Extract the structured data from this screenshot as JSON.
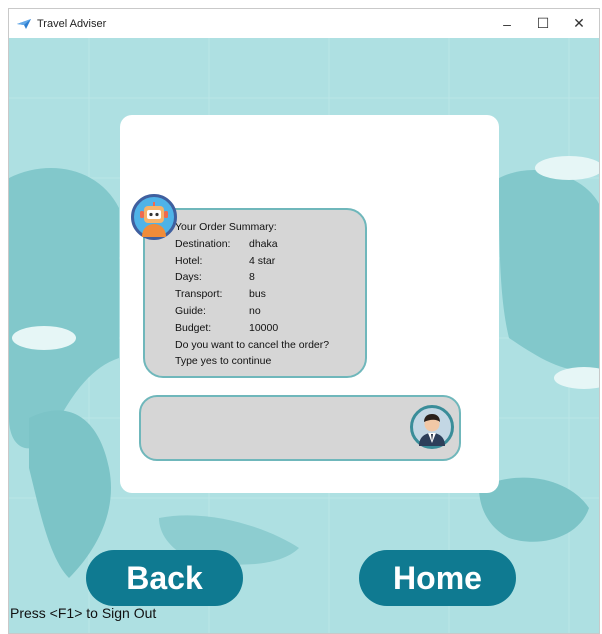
{
  "window": {
    "title": "Travel Adviser",
    "controls": {
      "minimize": "–",
      "maximize": "☐",
      "close": "✕"
    }
  },
  "chat": {
    "bot_lines": {
      "heading": "Your Order Summary:",
      "destination_label": "Destination:",
      "destination_value": "dhaka",
      "hotel_label": "Hotel:",
      "hotel_value": "4 star",
      "days_label": "Days:",
      "days_value": "8",
      "transport_label": "Transport:",
      "transport_value": "bus",
      "guide_label": "Guide:",
      "guide_value": "no",
      "budget_label": "Budget:",
      "budget_value": "10000",
      "question": "Do you want to cancel the order?",
      "prompt": "Type yes to continue"
    },
    "input_value": ""
  },
  "buttons": {
    "back": "Back",
    "home": "Home"
  },
  "footer": {
    "hint": "Press <F1> to Sign Out"
  },
  "colors": {
    "background": "#aee0e2",
    "button": "#0f7a91",
    "bubble": "#d6d6d6",
    "bubble_border": "#6fb7bb"
  },
  "icons": {
    "app": "paper-plane-icon",
    "bot": "robot-avatar",
    "user": "user-avatar"
  }
}
